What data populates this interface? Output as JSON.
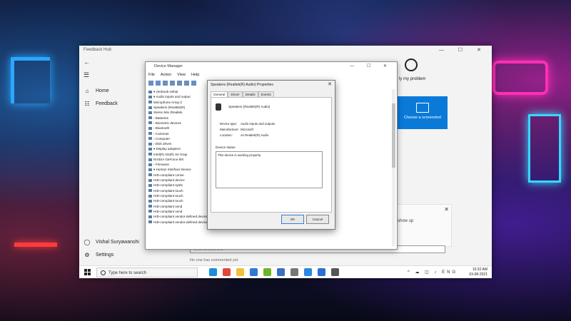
{
  "feedback_hub": {
    "title": "Feedback Hub",
    "window_controls": "— ☐ ✕",
    "nav": [
      {
        "label": "Home",
        "icon": "home-icon"
      },
      {
        "label": "Feedback",
        "icon": "feedback-icon"
      }
    ],
    "user": {
      "label": "Vishal Suryawanshi",
      "icon": "user-icon"
    },
    "settings": {
      "label": "Settings",
      "icon": "gear-icon"
    },
    "report_label": "ly my problem",
    "tile_label": "Choose a screenshot",
    "show_up_text": "show up",
    "comment_placeholder": "Write a comment",
    "no_comments": "No one has commented yet"
  },
  "device_manager": {
    "title": "Device Manager",
    "window_controls": "— ☐ ✕",
    "menu": [
      "File",
      "Action",
      "View",
      "Help"
    ],
    "tree": [
      "▾ zenbook-vishal",
      "  ▾ Audio inputs and output",
      "     Microphone Array (I",
      "     Speakers (Realtek(R)",
      "     Stereo Mix (Realtek",
      "  › Batteries",
      "  › Biometric devices",
      "  › Bluetooth",
      "  › Cameras",
      "  › Computer",
      "  › Disk drives",
      "  ▾ Display adapters",
      "     Intel(R) Iris(R) Xe Grap",
      "     NVIDIA GeForce MX",
      "  › Firmware",
      "  ▾ Human Interface Device",
      "     HID-compliant conse",
      "     HID-compliant device",
      "     HID-compliant syste",
      "     HID-compliant touch",
      "     HID-compliant touch",
      "     HID-compliant touch",
      "     HID-compliant vend",
      "     HID-compliant vend",
      "     HID-compliant vendor-defined device",
      "     HID-compliant vendor-defined device"
    ]
  },
  "properties_dialog": {
    "title": "Speakers (Realtek(R) Audio) Properties",
    "close": "✕",
    "tabs": [
      "General",
      "Driver",
      "Details",
      "Events"
    ],
    "device_name": "Speakers (Realtek(R) Audio)",
    "rows": [
      {
        "key": "Device type:",
        "value": "Audio inputs and outputs"
      },
      {
        "key": "Manufacturer:",
        "value": "Microsoft"
      },
      {
        "key": "Location:",
        "value": "on Realtek(R) Audio"
      }
    ],
    "status_label": "Device status",
    "status_text": "This device is working properly.",
    "ok": "OK",
    "cancel": "Cancel"
  },
  "taskbar": {
    "search_placeholder": "Type here to search",
    "tray": "^ ☁ ◫ ♪ ENG",
    "time": "10:32 AM",
    "date": "03-08-2021",
    "apps": [
      {
        "icon": "edge-icon",
        "color": "#1a8fd8"
      },
      {
        "icon": "chrome-icon",
        "color": "#e2463a"
      },
      {
        "icon": "file-explorer-icon",
        "color": "#f2c035"
      },
      {
        "icon": "mail-icon",
        "color": "#2f78d4"
      },
      {
        "icon": "nvidia-icon",
        "color": "#6fb32a"
      },
      {
        "icon": "photos-icon",
        "color": "#3a6fc4"
      },
      {
        "icon": "settings-icon",
        "color": "#777777"
      },
      {
        "icon": "browser-icon",
        "color": "#2a88e0"
      },
      {
        "icon": "store-icon",
        "color": "#2b6fd1"
      },
      {
        "icon": "app-icon",
        "color": "#555555"
      }
    ]
  }
}
